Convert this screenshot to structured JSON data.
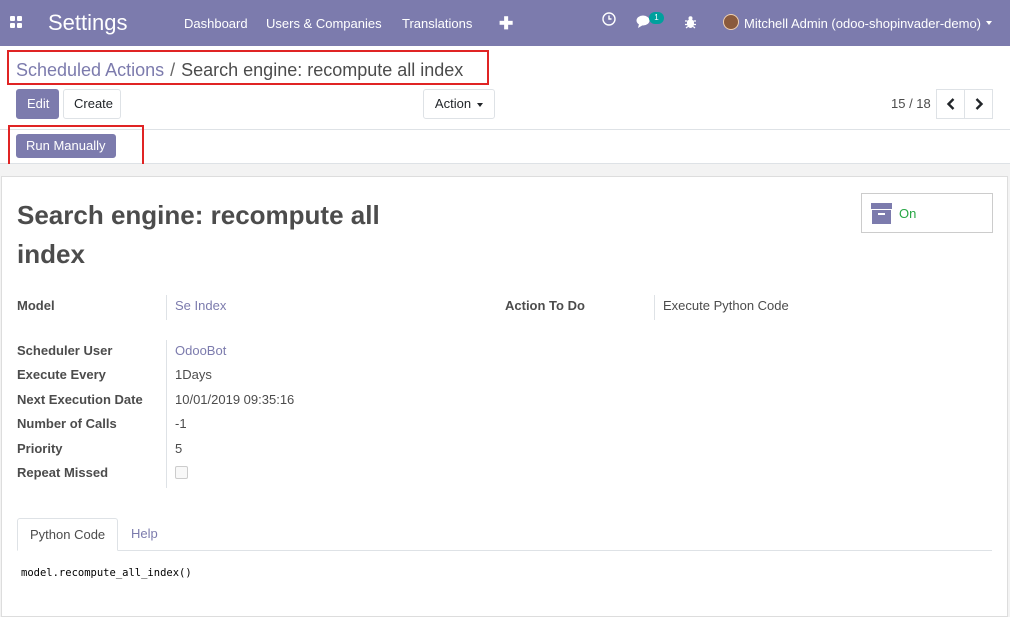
{
  "topbar": {
    "app_title": "Settings",
    "menu": [
      "Dashboard",
      "Users & Companies",
      "Translations"
    ],
    "chat_badge": "1",
    "user_name": "Mitchell Admin (odoo-shopinvader-demo)",
    "icons": [
      "apps-grid-icon",
      "plus-icon",
      "clock-icon",
      "chat-icon",
      "bug-icon",
      "avatar",
      "caret-down-icon"
    ]
  },
  "breadcrumb": {
    "parent": "Scheduled Actions",
    "separator": "/",
    "current": "Search engine: recompute all index"
  },
  "buttons": {
    "edit": "Edit",
    "create": "Create",
    "action": "Action",
    "run_manually": "Run Manually"
  },
  "pager": {
    "value": "15 / 18",
    "prev_icon": "chevron-left-icon",
    "next_icon": "chevron-right-icon"
  },
  "record": {
    "title_line1": "Search engine: recompute all",
    "title_line2": "index",
    "active_label": "On"
  },
  "fields": {
    "model_label": "Model",
    "model_value": "Se Index",
    "action_label": "Action To Do",
    "action_value": "Execute Python Code",
    "scheduler_user_label": "Scheduler User",
    "scheduler_user_value": "OdooBot",
    "execute_every_label": "Execute Every",
    "execute_every_value": "1Days",
    "next_exec_label": "Next Execution Date",
    "next_exec_value": "10/01/2019 09:35:16",
    "num_calls_label": "Number of Calls",
    "num_calls_value": "-1",
    "priority_label": "Priority",
    "priority_value": "5",
    "repeat_missed_label": "Repeat Missed",
    "repeat_missed_checked": false
  },
  "tabs": [
    "Python Code",
    "Help"
  ],
  "code": "model.recompute_all_index()",
  "colors": {
    "brand": "#7c7bad",
    "active_green": "#28a745",
    "highlight_red": "#e02424"
  }
}
